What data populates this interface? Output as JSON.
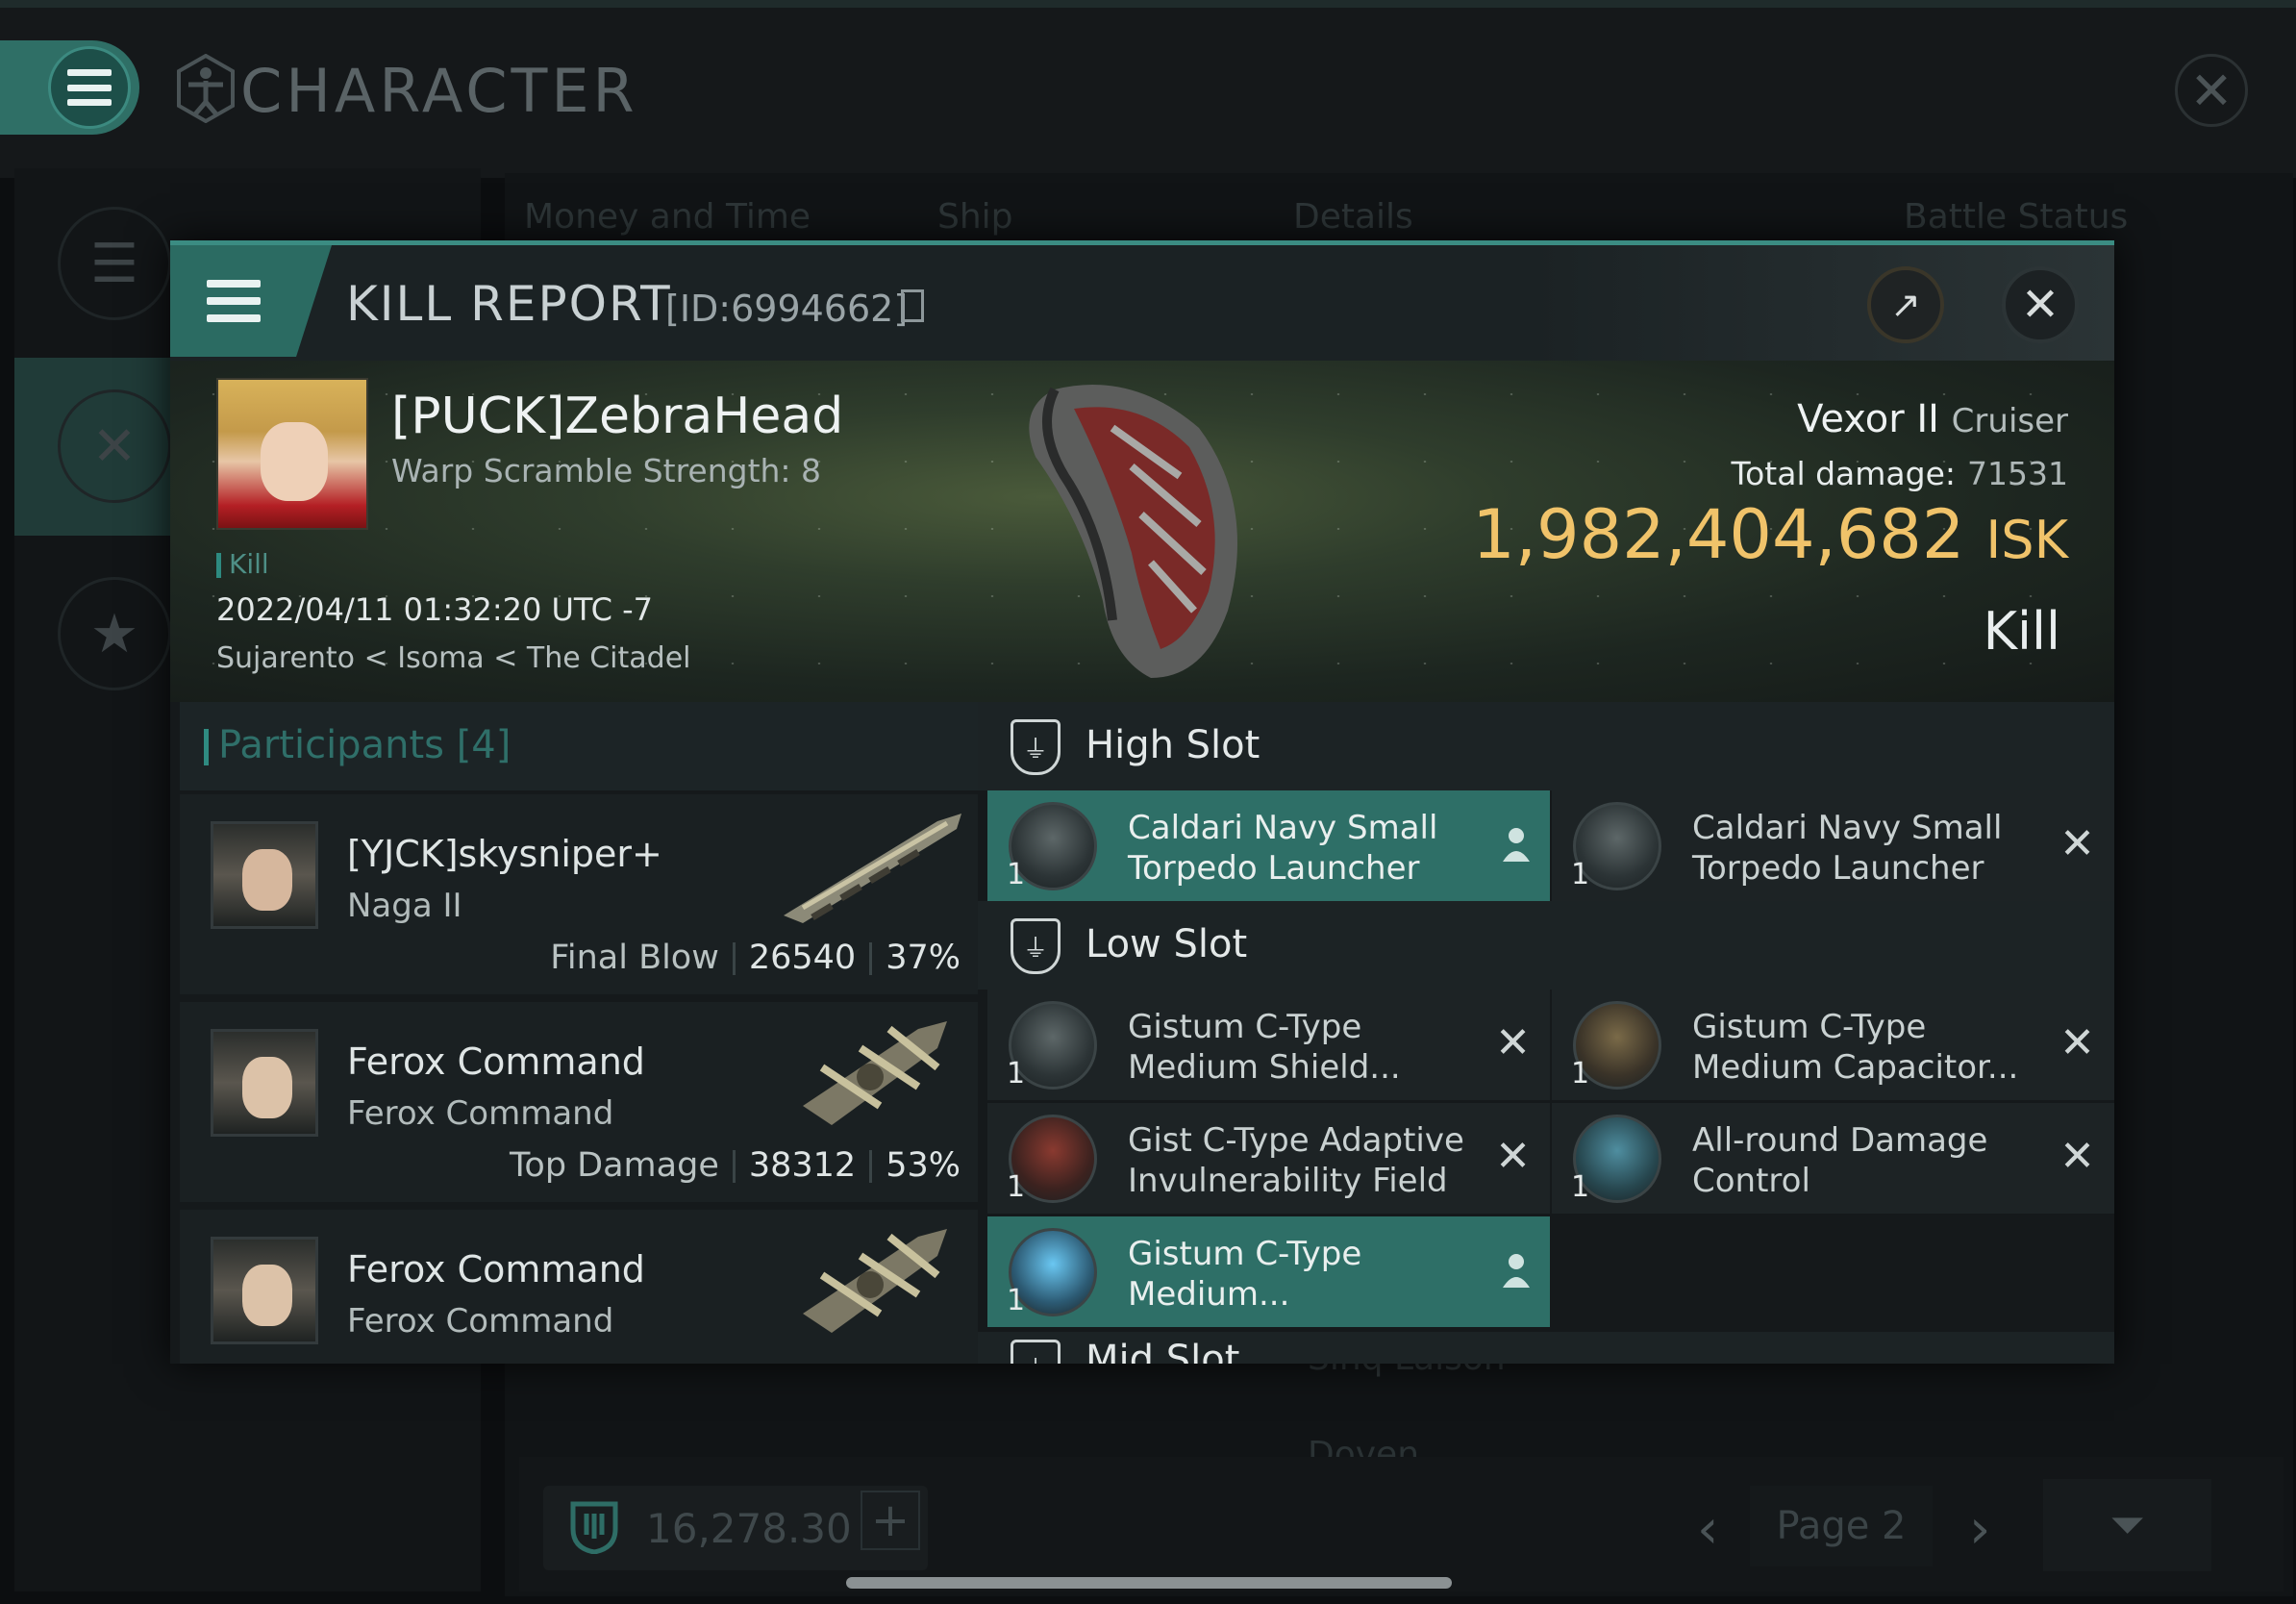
{
  "app": {
    "title": "CHARACTER",
    "tabs": [
      "Money and Time",
      "Ship",
      "Details",
      "Battle Status"
    ],
    "wallet_amount": "16,278.30",
    "page_label": "Page 2",
    "bg_rows": [
      "Sinq Laison",
      "Doven"
    ]
  },
  "kill_report": {
    "title": "KILL REPORT",
    "id": "[ID:6994662]",
    "victim": {
      "name": "[PUCK]ZebraHead",
      "warp_scramble": "Warp Scramble Strength: 8",
      "tag": "Kill",
      "date": "2022/04/11 01:32:20 UTC -7",
      "location": "Sujarento < Isoma < The Citadel",
      "ship_name": "Vexor II",
      "ship_class": "Cruiser",
      "total_damage_label": "Total damage:",
      "total_damage": "71531",
      "isk_value": "1,982,404,682",
      "isk_unit": "ISK",
      "result": "Kill"
    },
    "participants": {
      "title": "Participants",
      "count": "[4]",
      "rows": [
        {
          "name": "[YJCK]skysniper+",
          "ship": "Naga II",
          "label": "Final Blow",
          "damage": "26540",
          "percent": "37%"
        },
        {
          "name": "Ferox Command",
          "ship": "Ferox Command",
          "label": "Top Damage",
          "damage": "38312",
          "percent": "53%"
        },
        {
          "name": "Ferox Command",
          "ship": "Ferox Command"
        }
      ]
    },
    "fitting": {
      "high_slot_title": "High Slot",
      "low_slot_title": "Low Slot",
      "mid_slot_title": "Mid Slot",
      "high": [
        {
          "qty": "1",
          "name": "Caldari Navy Small Torpedo Launcher",
          "status": "dropped"
        },
        {
          "qty": "1",
          "name": "Caldari Navy Small Torpedo Launcher",
          "status": "destroyed"
        }
      ],
      "low": [
        {
          "qty": "1",
          "name": "Gistum C-Type Medium Shield...",
          "status": "destroyed"
        },
        {
          "qty": "1",
          "name": "Gistum C-Type Medium Capacitor...",
          "status": "destroyed"
        },
        {
          "qty": "1",
          "name": "Gist C-Type Adaptive Invulnerability Field",
          "status": "destroyed"
        },
        {
          "qty": "1",
          "name": "All-round Damage Control",
          "status": "destroyed"
        },
        {
          "qty": "1",
          "name": "Gistum C-Type Medium...",
          "status": "dropped"
        }
      ]
    }
  }
}
